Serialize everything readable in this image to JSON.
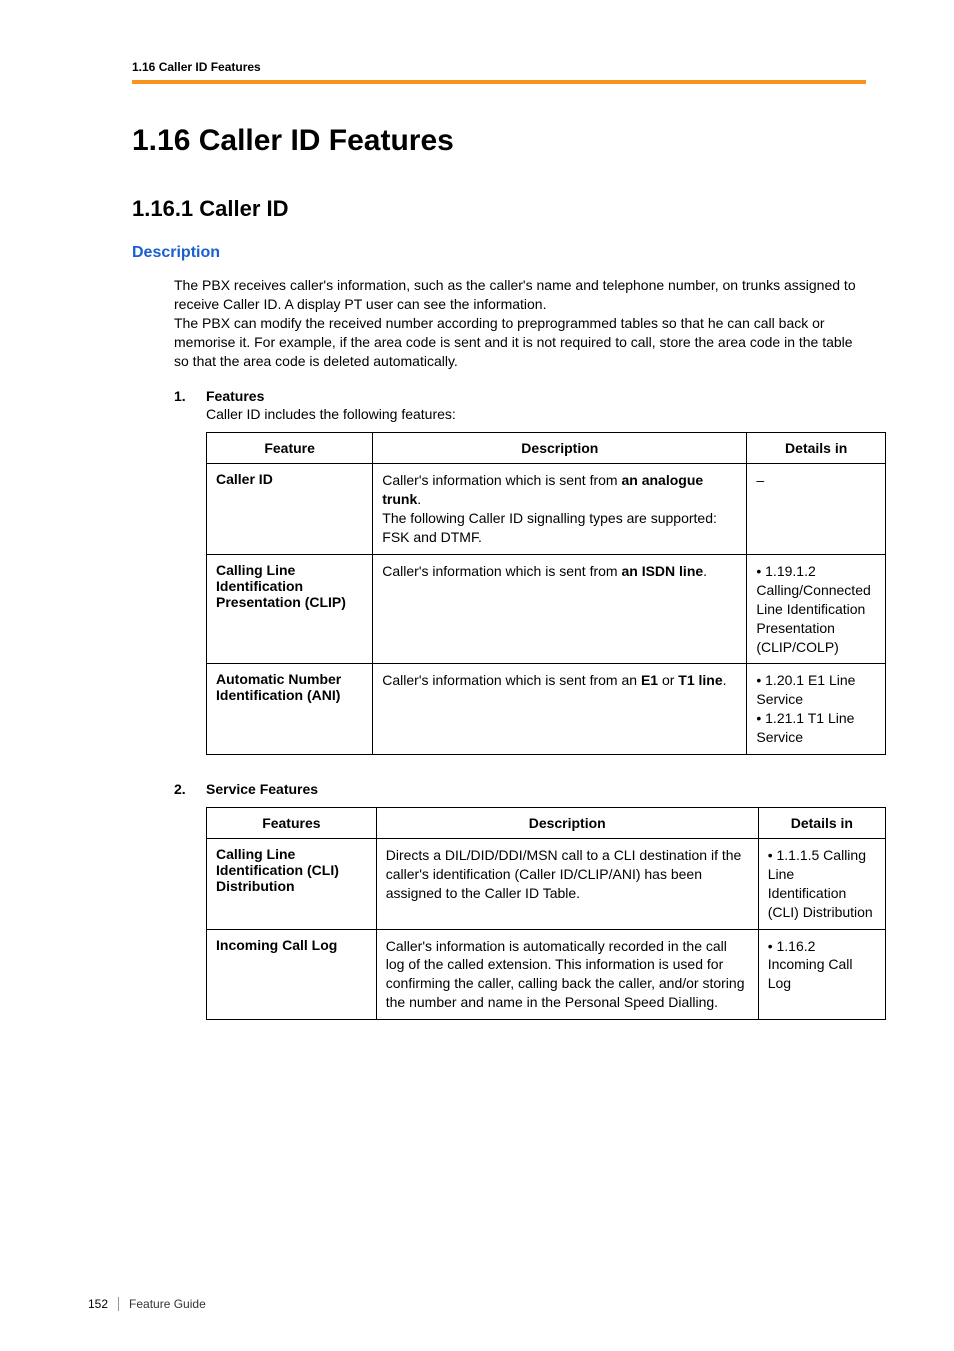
{
  "runningHeader": "1.16 Caller ID Features",
  "h1": "1.16   Caller ID Features",
  "h2": "1.16.1  Caller ID",
  "h3": "Description",
  "intro_p1": "The PBX receives caller's information, such as the caller's name and telephone number, on trunks assigned to receive Caller ID. A display PT user can see the information.",
  "intro_p2": "The PBX can modify the received number according to preprogrammed tables so that he can call back or memorise it. For example, if the area code is sent and it is not required to call, store the area code in the table so that the area code is deleted automatically.",
  "list1": {
    "num": "1.",
    "title": "Features",
    "sub": "Caller ID includes the following features:"
  },
  "list2": {
    "num": "2.",
    "title": "Service Features"
  },
  "table1": {
    "headers": {
      "c1": "Feature",
      "c2": "Description",
      "c3": "Details in"
    },
    "rows": [
      {
        "feature": "Caller ID",
        "desc_pre": "Caller's information which is sent from",
        "desc_bold": "an analogue trunk",
        "desc_post": ".",
        "desc_extra": "The following Caller ID signalling types are supported: FSK and DTMF.",
        "details": "–"
      },
      {
        "feature": "Calling Line Identification Presentation (CLIP)",
        "desc_pre": "Caller's information which is sent from",
        "desc_bold": "an ISDN line",
        "desc_post": ".",
        "desc_extra": "",
        "details": "• 1.19.1.2 Calling/Connected Line Identification Presentation (CLIP/COLP)"
      },
      {
        "feature": "Automatic Number Identification (ANI)",
        "desc_pre": "Caller's information which is sent from an ",
        "desc_bold": "E1",
        "desc_mid": " or ",
        "desc_bold2": "T1 line",
        "desc_post": ".",
        "details_l1": "• 1.20.1 E1 Line Service",
        "details_l2": "• 1.21.1 T1 Line Service"
      }
    ]
  },
  "table2": {
    "headers": {
      "c1": "Features",
      "c2": "Description",
      "c3": "Details in"
    },
    "rows": [
      {
        "feature": "Calling Line Identification (CLI) Distribution",
        "desc": "Directs a DIL/DID/DDI/MSN call to a CLI destination if the caller's identification (Caller ID/CLIP/ANI) has been assigned to the Caller ID Table.",
        "details": "• 1.1.1.5 Calling Line Identification (CLI) Distribution"
      },
      {
        "feature": "Incoming Call Log",
        "desc": "Caller's information is automatically recorded in the call log of the called extension. This information is used for confirming the caller, calling back the caller, and/or storing the number and name in the Personal Speed Dialling.",
        "details": "•  1.16.2 Incoming Call Log"
      }
    ]
  },
  "footer": {
    "pageNum": "152",
    "guide": "Feature Guide"
  }
}
